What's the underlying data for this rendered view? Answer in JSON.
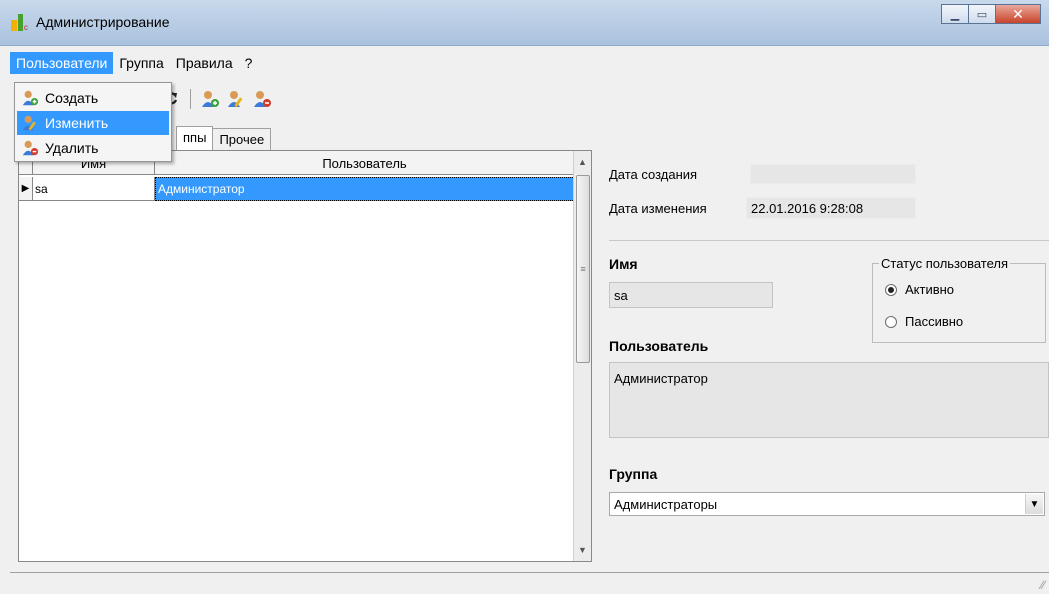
{
  "window": {
    "title": "Администрирование"
  },
  "menubar": {
    "items": [
      {
        "label": "Пользователи"
      },
      {
        "label": "Группа"
      },
      {
        "label": "Правила"
      },
      {
        "label": "?"
      }
    ]
  },
  "dropdown": {
    "items": [
      {
        "label": "Создать",
        "icon": "user-add-icon"
      },
      {
        "label": "Изменить",
        "icon": "user-edit-icon"
      },
      {
        "label": "Удалить",
        "icon": "user-delete-icon"
      }
    ]
  },
  "toolbar": {
    "icons": [
      "refresh-icon",
      "user-add-icon",
      "user-edit-icon",
      "user-delete-icon"
    ]
  },
  "tabs": [
    {
      "label": "ппы"
    },
    {
      "label": "Прочее"
    }
  ],
  "grid": {
    "columns": [
      "Имя",
      "Пользователь"
    ],
    "rows": [
      {
        "name": "sa",
        "user": "Администратор"
      }
    ]
  },
  "details": {
    "created_label": "Дата создания",
    "created_value": "",
    "modified_label": "Дата изменения",
    "modified_value": "22.01.2016 9:28:08",
    "name_label": "Имя",
    "name_value": "sa",
    "status_label": "Статус пользователя",
    "status_active": "Активно",
    "status_passive": "Пассивно",
    "user_label": "Пользователь",
    "user_value": "Администратор",
    "group_label": "Группа",
    "group_value": "Администраторы"
  },
  "colors": {
    "highlight": "#3399ff",
    "titlebar": "#b9cde5",
    "close": "#c8442b"
  }
}
